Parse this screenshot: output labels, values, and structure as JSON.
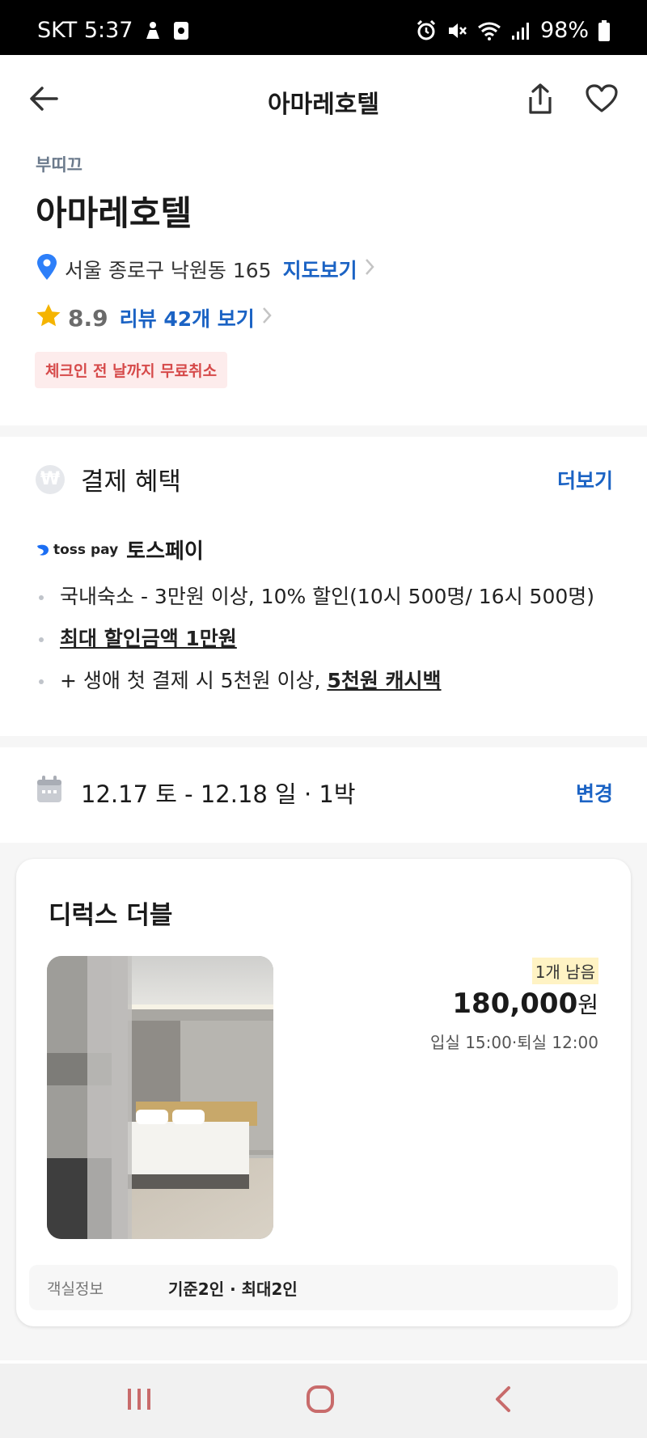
{
  "status_bar": {
    "carrier_time": "SKT 5:37",
    "battery": "98%",
    "icons": [
      "person-icon",
      "recorder-icon",
      "alarm-icon",
      "mute-icon",
      "wifi-icon",
      "signal-icon",
      "battery-icon"
    ]
  },
  "header": {
    "title": "아마레호텔",
    "back_icon": "arrow-left-icon",
    "share_icon": "share-icon",
    "like_icon": "heart-icon"
  },
  "hotel": {
    "category": "부띠끄",
    "name": "아마레호텔",
    "address": "서울 종로구 낙원동 165",
    "map_link": "지도보기",
    "rating": "8.9",
    "reviews_link": "리뷰 42개 보기",
    "cancel_badge": "체크인 전 날까지 무료취소"
  },
  "benefits": {
    "title": "결제 혜택",
    "more": "더보기",
    "provider_logo": "toss pay",
    "provider_name": "토스페이",
    "item1": "국내숙소 - 3만원 이상, 10% 할인(10시 500명/ 16시 500명)",
    "item2": "최대 할인금액 1만원",
    "item3_prefix": "+ 생애 첫 결제 시 5천원 이상, ",
    "item3_highlight": "5천원 캐시백"
  },
  "stay": {
    "dates": "12.17 토 - 12.18 일 · 1박",
    "change": "변경"
  },
  "room": {
    "name": "디럭스 더블",
    "remaining": "1개 남음",
    "price": "180,000",
    "currency": "원",
    "checkin_checkout": "입실 15:00·퇴실 12:00",
    "info_label": "객실정보",
    "info_value": "기준2인 · 최대2인"
  },
  "colors": {
    "accent": "#1b63c4",
    "cancel_text": "#d64a4a",
    "cancel_bg": "#fdecec",
    "star": "#f5b400",
    "pin": "#2d7ff9"
  },
  "nav": {
    "recents_icon": "recents-icon",
    "home_icon": "home-icon",
    "back_icon": "back-icon"
  }
}
